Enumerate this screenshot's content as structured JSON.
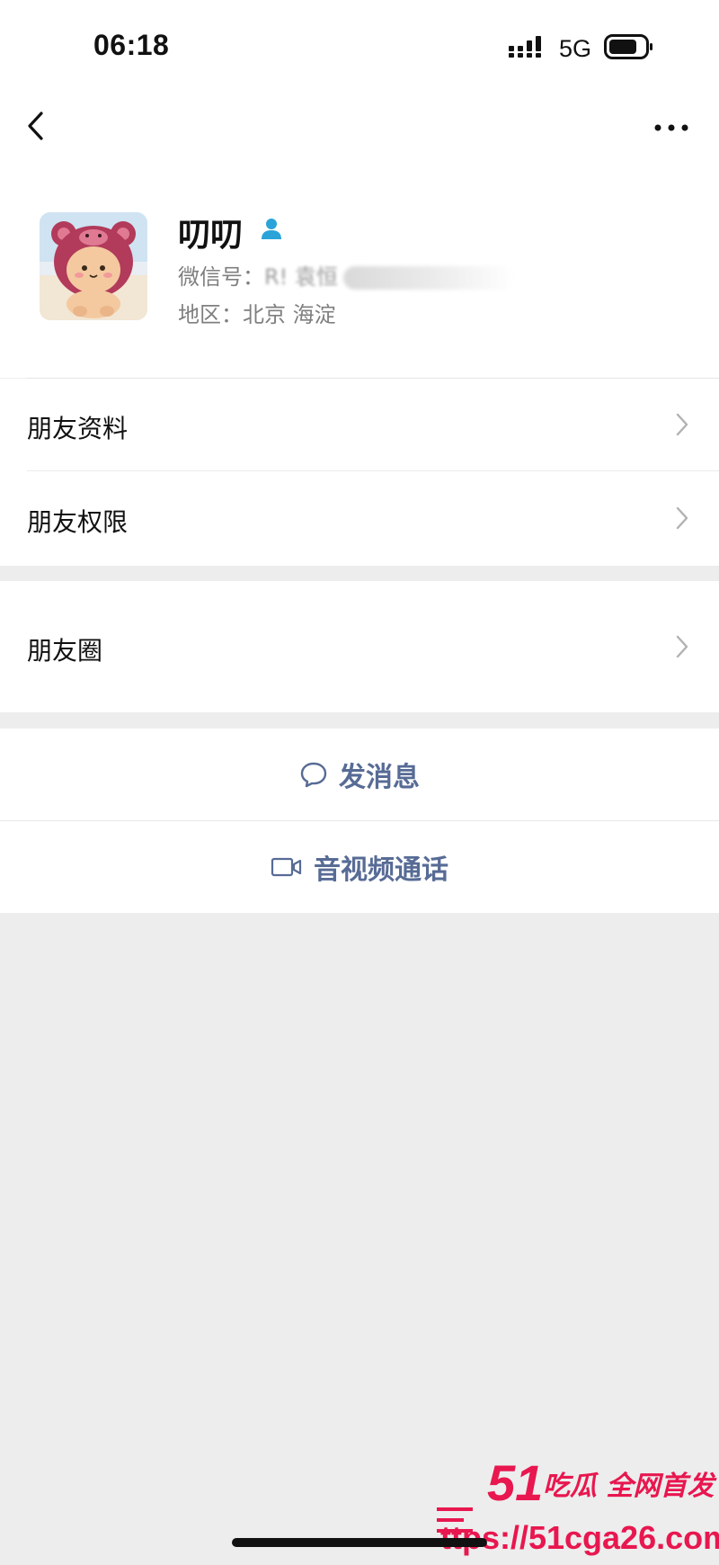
{
  "status_bar": {
    "time": "06:18",
    "network": "5G"
  },
  "nav": {
    "back_icon": "chevron-left-icon",
    "more_icon": "ellipsis-icon"
  },
  "profile": {
    "name": "叨叨",
    "wechat_id_label": "微信号：",
    "wechat_id_value": "R! 袁恒",
    "region_label": "地区：",
    "region_value": "北京 海淀",
    "badge_icon": "person-icon",
    "badge_color": "#1aad19"
  },
  "list": {
    "friend_info": "朋友资料",
    "friend_permissions": "朋友权限",
    "moments": "朋友圈"
  },
  "actions": {
    "send_message": "发消息",
    "video_call": "音视频通话",
    "accent_color": "#576b95"
  },
  "watermark": {
    "brand_number": "51",
    "brand_text": "吃瓜 全网首发",
    "url": "ttps://51cga26.com",
    "color": "#e8174f"
  }
}
